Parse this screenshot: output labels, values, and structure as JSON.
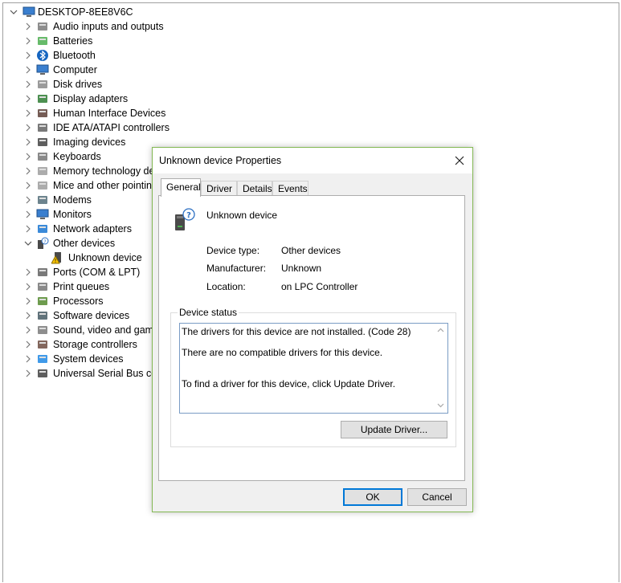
{
  "tree": {
    "root": "DESKTOP-8EE8V6C",
    "items": [
      {
        "label": "Audio inputs and outputs",
        "icon": "speaker-icon",
        "expanded": false
      },
      {
        "label": "Batteries",
        "icon": "battery-icon",
        "expanded": false
      },
      {
        "label": "Bluetooth",
        "icon": "bluetooth-icon",
        "expanded": false
      },
      {
        "label": "Computer",
        "icon": "monitor-icon",
        "expanded": false
      },
      {
        "label": "Disk drives",
        "icon": "disk-drive-icon",
        "expanded": false
      },
      {
        "label": "Display adapters",
        "icon": "display-adapter-icon",
        "expanded": false
      },
      {
        "label": "Human Interface Devices",
        "icon": "hid-icon",
        "expanded": false
      },
      {
        "label": "IDE ATA/ATAPI controllers",
        "icon": "ide-controller-icon",
        "expanded": false
      },
      {
        "label": "Imaging devices",
        "icon": "camera-icon",
        "expanded": false
      },
      {
        "label": "Keyboards",
        "icon": "keyboard-icon",
        "expanded": false
      },
      {
        "label": "Memory technology de",
        "icon": "memory-icon",
        "expanded": false
      },
      {
        "label": "Mice and other pointin",
        "icon": "mouse-icon",
        "expanded": false
      },
      {
        "label": "Modems",
        "icon": "modem-icon",
        "expanded": false
      },
      {
        "label": "Monitors",
        "icon": "monitor-icon",
        "expanded": false
      },
      {
        "label": "Network adapters",
        "icon": "network-icon",
        "expanded": false
      },
      {
        "label": "Other devices",
        "icon": "unknown-device-icon",
        "expanded": true
      },
      {
        "label": "Unknown device",
        "icon": "warning-device-icon",
        "child": true
      },
      {
        "label": "Ports (COM & LPT)",
        "icon": "port-icon",
        "expanded": false
      },
      {
        "label": "Print queues",
        "icon": "printer-icon",
        "expanded": false
      },
      {
        "label": "Processors",
        "icon": "processor-icon",
        "expanded": false
      },
      {
        "label": "Software devices",
        "icon": "software-device-icon",
        "expanded": false
      },
      {
        "label": "Sound, video and game",
        "icon": "speaker-icon",
        "expanded": false
      },
      {
        "label": "Storage controllers",
        "icon": "storage-icon",
        "expanded": false
      },
      {
        "label": "System devices",
        "icon": "system-icon",
        "expanded": false
      },
      {
        "label": "Universal Serial Bus con",
        "icon": "usb-icon",
        "expanded": false
      }
    ]
  },
  "dialog": {
    "title": "Unknown device Properties",
    "close_glyph": "✕",
    "tabs": [
      "General",
      "Driver",
      "Details",
      "Events"
    ],
    "active_tab": "General",
    "device_name": "Unknown device",
    "props": [
      {
        "label": "Device type:",
        "value": "Other devices"
      },
      {
        "label": "Manufacturer:",
        "value": "Unknown"
      },
      {
        "label": "Location:",
        "value": "on LPC Controller"
      }
    ],
    "status_legend": "Device status",
    "status_lines": [
      "The drivers for this device are not installed. (Code 28)",
      "There are no compatible drivers for this device.",
      "To find a driver for this device, click Update Driver."
    ],
    "update_driver": "Update Driver...",
    "ok": "OK",
    "cancel": "Cancel"
  },
  "colors": {
    "accent": "#0078d7",
    "dialog_border": "#83b853"
  }
}
